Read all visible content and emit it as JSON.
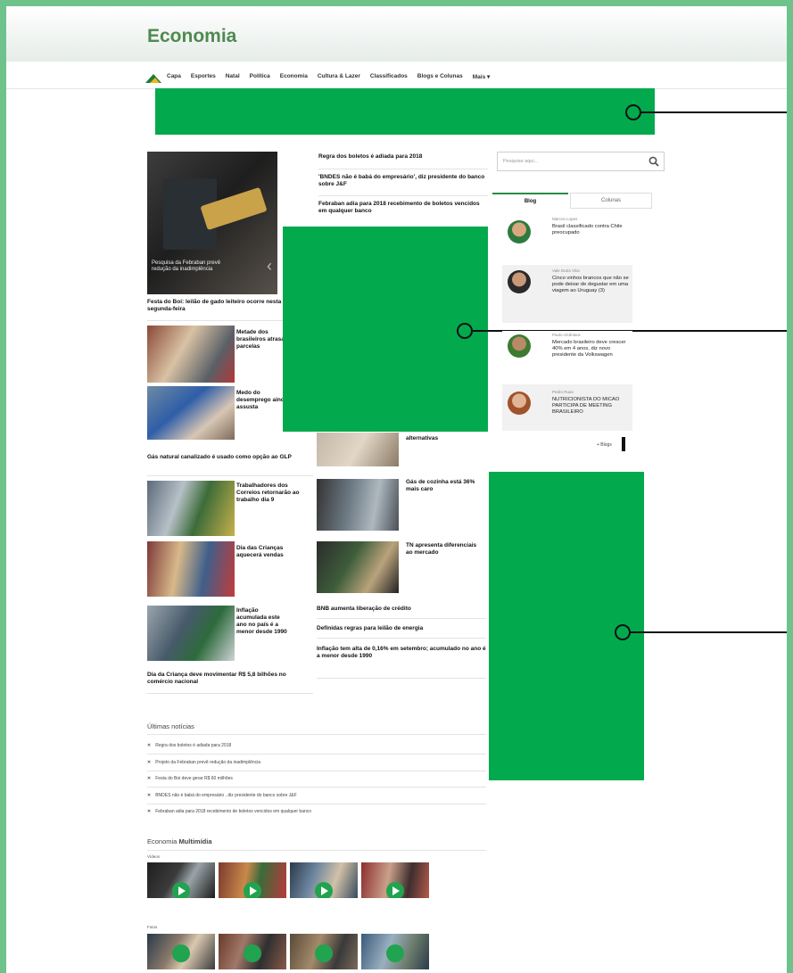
{
  "header": {
    "title": "Economia"
  },
  "nav": {
    "items": [
      "Capa",
      "Esportes",
      "Natal",
      "Política",
      "Economia",
      "Cultura & Lazer",
      "Classificados",
      "Blogs e Colunas",
      "Mais ▾"
    ]
  },
  "hero": {
    "caption": "Pesquisa da Febraban prevê redução da inadimplência"
  },
  "main": {
    "festa_headline": "Festa do Boi: leilão de gado leiteiro ocorre nesta segunda-feira",
    "left_items": [
      "Metade dos brasileiros atrasa parcelas",
      "Medo do desemprego ainda assusta"
    ],
    "gas_headline": "Gás natural canalizado é usado como opção ao GLP",
    "left_items2": [
      "Trabalhadores dos Correios retornarão ao trabalho dia 9",
      "Dia das Crianças aquecerá vendas",
      "Inflação acumulada este ano no país é a menor desde 1990"
    ],
    "dia_headline": "Dia da Criança deve movimentar R$ 5,8 bilhões no comércio nacional",
    "mid_headlines": [
      "Regra dos boletos é adiada para 2018",
      "'BNDES não é babá do empresário', diz presidente do banco sobre J&F",
      "Febraban adia para 2018 recebimento de boletos vencidos em qualquer banco"
    ],
    "mid_item_alternativas": "alternativas",
    "mid_items": [
      "Gás de cozinha está 36% mais caro",
      "TN apresenta diferenciais ao mercado"
    ],
    "mid_headlines2": [
      "BNB aumenta liberação de crédito",
      "Definidas regras para leilão de energia",
      "Inflação tem alta de 0,16% em setembro; acumulado no ano é a menor desde 1990"
    ]
  },
  "sidebar": {
    "search_placeholder": "Pesquise aqui...",
    "tabs": [
      "Blog",
      "Colunas"
    ],
    "blogs": [
      {
        "author": "Marcos Lopes",
        "text": "Brasil classificado contra Chile preocupado"
      },
      {
        "author": "Vale Dutra Vilar",
        "text": "Cinco vinhos brancos que não se pode deixar de degustar em uma viagem ao Uruguay (3)"
      },
      {
        "author": "Paulo Alcântara",
        "text": "Mercado brasileiro deve crescer 40% em 4 anos, diz novo presidente da Volkswagen"
      },
      {
        "author": "Pedro Ruas",
        "text": "NUTRICIONISTA DO MICAO PARTICIPA DE MEETING BRASILEIRO"
      }
    ],
    "more_link": "+ Blogs"
  },
  "latest": {
    "title": "Últimas notícias",
    "items": [
      "Regra dos boletos é adiada para 2018",
      "Projeto da Febraban prevê redução da inadimplência",
      "Festa do Boi deve gerar R$ 60 milhões",
      "BNDES não é babá do empresário , diz presidente do banco sobre J&F",
      "Febraban adia para 2018 recebimento de boletos vencidos em qualquer banco"
    ]
  },
  "multimedia": {
    "title_plain": "Economia ",
    "title_bold": "Multimídia",
    "videos_label": "Vídeos",
    "photos_label": "Fotos"
  },
  "colors": {
    "brand": "#4f8a4f",
    "placeholder_block": "#03a94d",
    "frame": "#6ec38c"
  }
}
